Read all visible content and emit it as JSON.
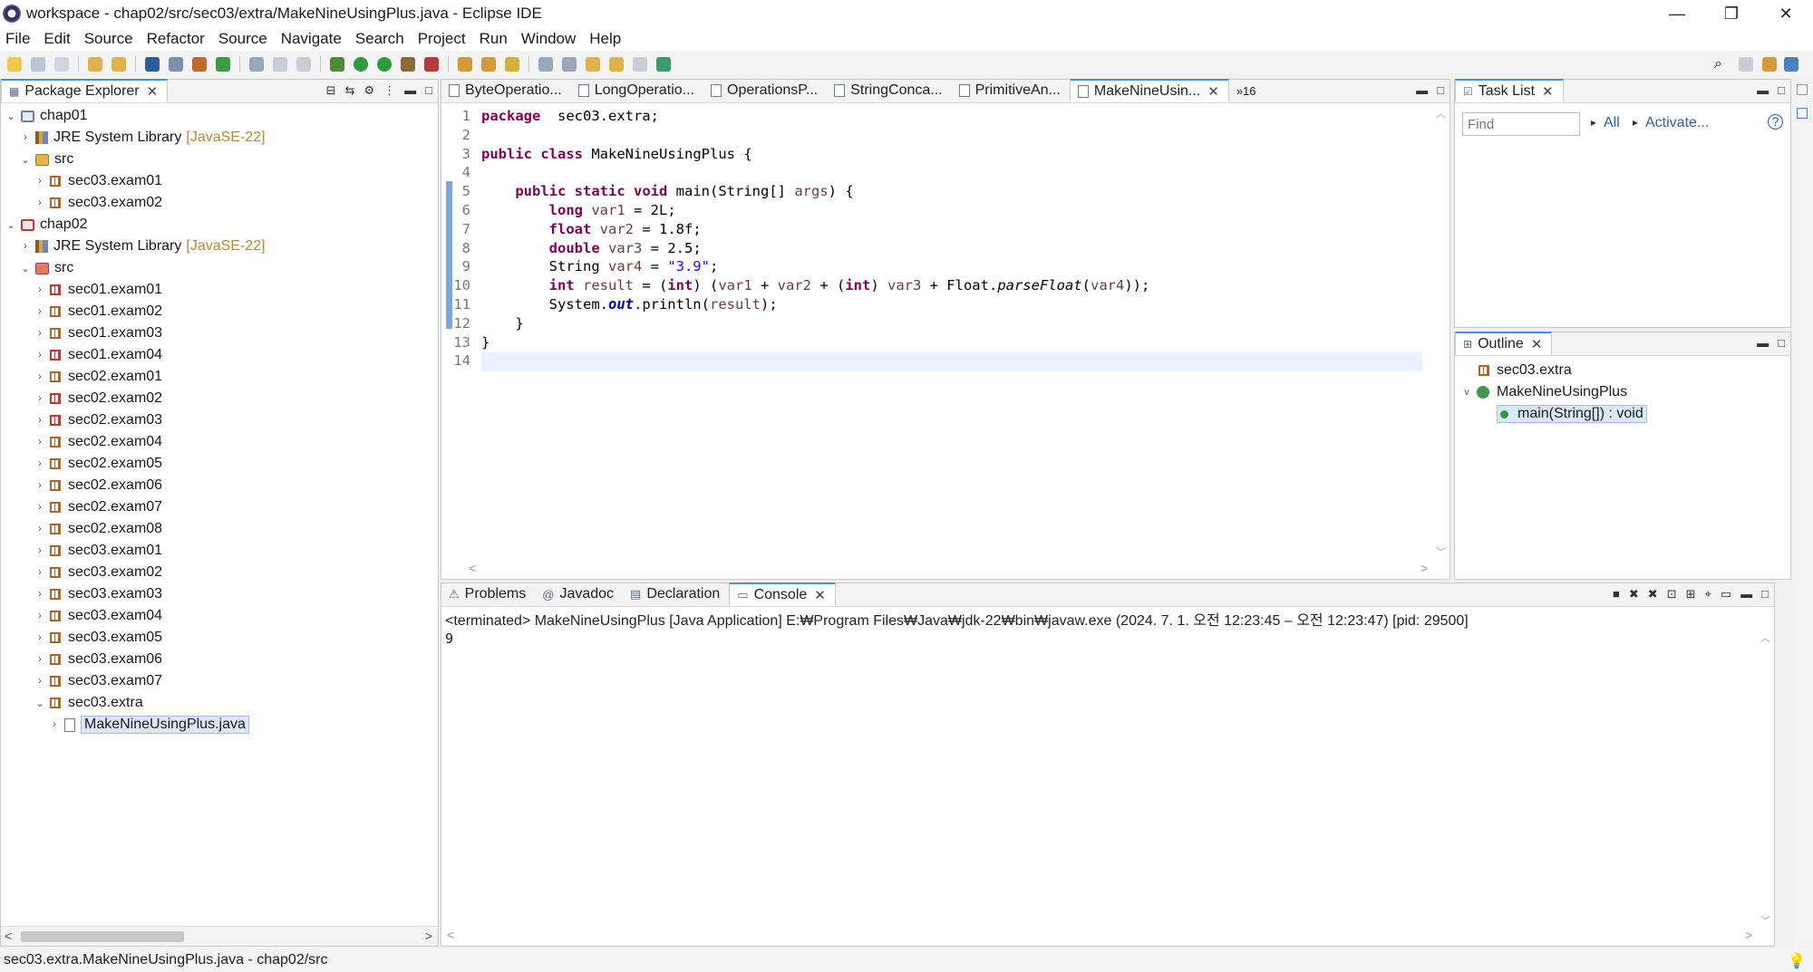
{
  "window": {
    "title": "workspace - chap02/src/sec03/extra/MakeNineUsingPlus.java - Eclipse IDE",
    "controls": [
      "—",
      "❐",
      "✕"
    ]
  },
  "menu": [
    "File",
    "Edit",
    "Source",
    "Refactor",
    "Source",
    "Navigate",
    "Search",
    "Project",
    "Run",
    "Window",
    "Help"
  ],
  "package_explorer": {
    "tab_label": "Package Explorer",
    "tree": [
      {
        "indent": 0,
        "twisty": "v",
        "icon": "project",
        "label": "chap01",
        "suffix": ""
      },
      {
        "indent": 1,
        "twisty": ">",
        "icon": "library",
        "label": "JRE System Library",
        "suffix": "[JavaSE-22]"
      },
      {
        "indent": 1,
        "twisty": "v",
        "icon": "src",
        "label": "src",
        "suffix": ""
      },
      {
        "indent": 2,
        "twisty": ">",
        "icon": "package",
        "label": "sec03.exam01",
        "suffix": ""
      },
      {
        "indent": 2,
        "twisty": ">",
        "icon": "package",
        "label": "sec03.exam02",
        "suffix": ""
      },
      {
        "indent": 0,
        "twisty": "v",
        "icon": "project-error",
        "label": "chap02",
        "suffix": ""
      },
      {
        "indent": 1,
        "twisty": ">",
        "icon": "library",
        "label": "JRE System Library",
        "suffix": "[JavaSE-22]"
      },
      {
        "indent": 1,
        "twisty": "v",
        "icon": "src-error",
        "label": "src",
        "suffix": ""
      },
      {
        "indent": 2,
        "twisty": ">",
        "icon": "package-error",
        "label": "sec01.exam01",
        "suffix": ""
      },
      {
        "indent": 2,
        "twisty": ">",
        "icon": "package",
        "label": "sec01.exam02",
        "suffix": ""
      },
      {
        "indent": 2,
        "twisty": ">",
        "icon": "package",
        "label": "sec01.exam03",
        "suffix": ""
      },
      {
        "indent": 2,
        "twisty": ">",
        "icon": "package-error",
        "label": "sec01.exam04",
        "suffix": ""
      },
      {
        "indent": 2,
        "twisty": ">",
        "icon": "package",
        "label": "sec02.exam01",
        "suffix": ""
      },
      {
        "indent": 2,
        "twisty": ">",
        "icon": "package-error",
        "label": "sec02.exam02",
        "suffix": ""
      },
      {
        "indent": 2,
        "twisty": ">",
        "icon": "package-error",
        "label": "sec02.exam03",
        "suffix": ""
      },
      {
        "indent": 2,
        "twisty": ">",
        "icon": "package",
        "label": "sec02.exam04",
        "suffix": ""
      },
      {
        "indent": 2,
        "twisty": ">",
        "icon": "package",
        "label": "sec02.exam05",
        "suffix": ""
      },
      {
        "indent": 2,
        "twisty": ">",
        "icon": "package",
        "label": "sec02.exam06",
        "suffix": ""
      },
      {
        "indent": 2,
        "twisty": ">",
        "icon": "package",
        "label": "sec02.exam07",
        "suffix": ""
      },
      {
        "indent": 2,
        "twisty": ">",
        "icon": "package",
        "label": "sec02.exam08",
        "suffix": ""
      },
      {
        "indent": 2,
        "twisty": ">",
        "icon": "package",
        "label": "sec03.exam01",
        "suffix": ""
      },
      {
        "indent": 2,
        "twisty": ">",
        "icon": "package",
        "label": "sec03.exam02",
        "suffix": ""
      },
      {
        "indent": 2,
        "twisty": ">",
        "icon": "package",
        "label": "sec03.exam03",
        "suffix": ""
      },
      {
        "indent": 2,
        "twisty": ">",
        "icon": "package",
        "label": "sec03.exam04",
        "suffix": ""
      },
      {
        "indent": 2,
        "twisty": ">",
        "icon": "package",
        "label": "sec03.exam05",
        "suffix": ""
      },
      {
        "indent": 2,
        "twisty": ">",
        "icon": "package",
        "label": "sec03.exam06",
        "suffix": ""
      },
      {
        "indent": 2,
        "twisty": ">",
        "icon": "package",
        "label": "sec03.exam07",
        "suffix": ""
      },
      {
        "indent": 2,
        "twisty": "v",
        "icon": "package",
        "label": "sec03.extra",
        "suffix": ""
      },
      {
        "indent": 3,
        "twisty": ">",
        "icon": "file",
        "label": "MakeNineUsingPlus.java",
        "suffix": "",
        "selected": true
      }
    ]
  },
  "editor": {
    "tabs": [
      {
        "label": "ByteOperatio...",
        "active": false
      },
      {
        "label": "LongOperatio...",
        "active": false
      },
      {
        "label": "OperationsP...",
        "active": false
      },
      {
        "label": "StringConca...",
        "active": false
      },
      {
        "label": "PrimitiveAn...",
        "active": false
      },
      {
        "label": "MakeNineUsin...",
        "active": true
      }
    ],
    "overflow": "»16",
    "current_line": 14,
    "lines": [
      [
        [
          "kw",
          "package"
        ],
        [
          "",
          "  sec03.extra;"
        ]
      ],
      [],
      [
        [
          "kw",
          "public"
        ],
        [
          "",
          " "
        ],
        [
          "kw",
          "class"
        ],
        [
          "",
          " MakeNineUsingPlus {"
        ]
      ],
      [],
      [
        [
          "",
          "    "
        ],
        [
          "kw",
          "public"
        ],
        [
          "",
          " "
        ],
        [
          "kw",
          "static"
        ],
        [
          "",
          " "
        ],
        [
          "kw",
          "void"
        ],
        [
          "",
          " main(String[] "
        ],
        [
          "var",
          "args"
        ],
        [
          "",
          ") {"
        ]
      ],
      [
        [
          "",
          "        "
        ],
        [
          "kw",
          "long"
        ],
        [
          "",
          " "
        ],
        [
          "var",
          "var1"
        ],
        [
          "",
          " = 2L;"
        ]
      ],
      [
        [
          "",
          "        "
        ],
        [
          "kw",
          "float"
        ],
        [
          "",
          " "
        ],
        [
          "var",
          "var2"
        ],
        [
          "",
          " = 1.8f;"
        ]
      ],
      [
        [
          "",
          "        "
        ],
        [
          "kw",
          "double"
        ],
        [
          "",
          " "
        ],
        [
          "var",
          "var3"
        ],
        [
          "",
          " = 2.5;"
        ]
      ],
      [
        [
          "",
          "        String "
        ],
        [
          "var",
          "var4"
        ],
        [
          "",
          " = "
        ],
        [
          "str",
          "\"3.9\""
        ],
        [
          "",
          ";"
        ]
      ],
      [
        [
          "",
          "        "
        ],
        [
          "kw",
          "int"
        ],
        [
          "",
          " "
        ],
        [
          "var",
          "result"
        ],
        [
          "",
          " = ("
        ],
        [
          "kw",
          "int"
        ],
        [
          "",
          ") ("
        ],
        [
          "var",
          "var1"
        ],
        [
          "",
          " + "
        ],
        [
          "var",
          "var2"
        ],
        [
          "",
          " + ("
        ],
        [
          "kw",
          "int"
        ],
        [
          "",
          ") "
        ],
        [
          "var",
          "var3"
        ],
        [
          "",
          " + Float."
        ],
        [
          "it",
          "parseFloat"
        ],
        [
          "",
          "("
        ],
        [
          "var",
          "var4"
        ],
        [
          "",
          "));"
        ]
      ],
      [
        [
          "",
          "        System."
        ],
        [
          "fld",
          "out"
        ],
        [
          "",
          ".println("
        ],
        [
          "var",
          "result"
        ],
        [
          "",
          ");"
        ]
      ],
      [
        [
          "",
          "    }"
        ]
      ],
      [
        [
          "",
          "}"
        ]
      ],
      []
    ]
  },
  "console": {
    "tabs": [
      {
        "label": "Problems",
        "active": false
      },
      {
        "label": "Javadoc",
        "active": false
      },
      {
        "label": "Declaration",
        "active": false
      },
      {
        "label": "Console",
        "active": true
      }
    ],
    "header": "<terminated> MakeNineUsingPlus [Java Application] E:₩Program Files₩Java₩jdk-22₩bin₩javaw.exe  (2024. 7. 1. 오전 12:23:45 – 오전 12:23:47) [pid: 29500]",
    "output": "9"
  },
  "task_list": {
    "tab_label": "Task List",
    "find_placeholder": "Find",
    "all_label": "All",
    "activate_label": "Activate..."
  },
  "outline": {
    "tab_label": "Outline",
    "package": "sec03.extra",
    "class": "MakeNineUsingPlus",
    "method": "main(String[]) : void"
  },
  "statusbar": {
    "text": "sec03.extra.MakeNineUsingPlus.java - chap02/src"
  },
  "colors": {
    "keyword": "#7f0055",
    "string": "#2a00ff",
    "field": "#0000c0",
    "variable": "#6a3e3e",
    "active_tab_accent": "#4a90d9"
  }
}
